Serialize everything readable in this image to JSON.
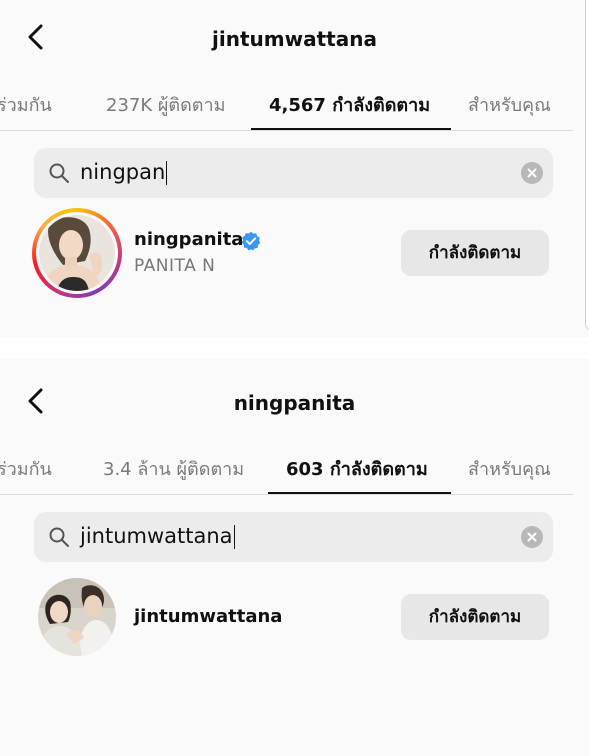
{
  "colors": {
    "background": "#fafafa",
    "button_bg": "#e7e7e7",
    "search_bg": "#ececec",
    "verified_blue": "#3897f0",
    "inactive_tab": "#7a7a7a"
  },
  "icons": [
    "chevron-left-icon",
    "search-icon",
    "clear-icon",
    "verified-badge-icon"
  ],
  "panels": [
    {
      "title": "jintumwattana",
      "tabs": [
        "ร่วมกัน",
        "237K ผู้ติดตาม",
        "4,567 กำลังติดตาม",
        "สำหรับคุณ"
      ],
      "active_tab": 2,
      "search_value": "ningpan",
      "result": {
        "username": "ningpanita",
        "full_name": "PANITA N",
        "verified": true,
        "button_label": "กำลังติดตาม"
      }
    },
    {
      "title": "ningpanita",
      "tabs": [
        "ร่วมกัน",
        "3.4 ล้าน ผู้ติดตาม",
        "603 กำลังติดตาม",
        "สำหรับคุณ"
      ],
      "active_tab": 2,
      "search_value": "jintumwattana",
      "result": {
        "username": "jintumwattana",
        "full_name": "",
        "verified": false,
        "button_label": "กำลังติดตาม"
      }
    }
  ]
}
